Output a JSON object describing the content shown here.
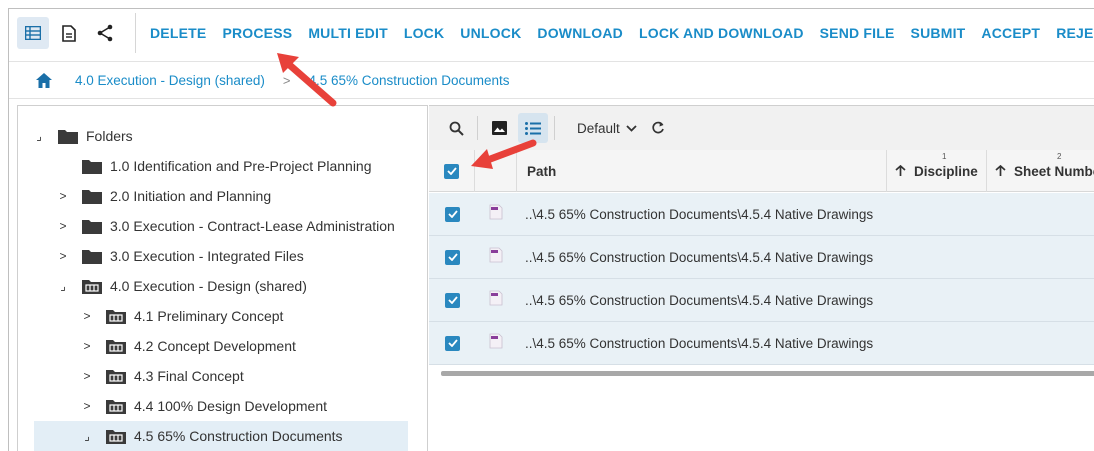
{
  "toolbar": {
    "icons": [
      "grid-view-icon",
      "document-icon",
      "share-icon"
    ],
    "actions": [
      "DELETE",
      "PROCESS",
      "MULTI EDIT",
      "LOCK",
      "UNLOCK",
      "DOWNLOAD",
      "LOCK AND DOWNLOAD",
      "SEND FILE",
      "SUBMIT",
      "ACCEPT",
      "REJECT"
    ]
  },
  "breadcrumb": {
    "items": [
      "4.0 Execution - Design (shared)",
      "4.5 65% Construction Documents"
    ],
    "separator": ">"
  },
  "tree": {
    "root": "Folders",
    "items": [
      {
        "label": "1.0 Identification and Pre-Project Planning",
        "twist": ""
      },
      {
        "label": "2.0 Initiation and Planning",
        "twist": ">"
      },
      {
        "label": "3.0 Execution - Contract-Lease Administration",
        "twist": ">"
      },
      {
        "label": "3.0 Execution - Integrated Files",
        "twist": ">"
      },
      {
        "label": "4.0 Execution - Design (shared)",
        "twist": "⌟"
      },
      {
        "label": "4.1 Preliminary Concept",
        "twist": ">"
      },
      {
        "label": "4.2 Concept Development",
        "twist": ">"
      },
      {
        "label": "4.3 Final Concept",
        "twist": ">"
      },
      {
        "label": "4.4 100% Design Development",
        "twist": ">"
      },
      {
        "label": "4.5 65% Construction Documents",
        "twist": "⌟"
      }
    ]
  },
  "grid": {
    "view": "Default",
    "columns": [
      {
        "label": "Path",
        "num": ""
      },
      {
        "label": "Discipline",
        "num": "1"
      },
      {
        "label": "Sheet Numbe",
        "num": "2"
      }
    ],
    "rows": [
      {
        "path": "..\\4.5 65% Construction Documents\\4.5.4 Native Drawings",
        "checked": true
      },
      {
        "path": "..\\4.5 65% Construction Documents\\4.5.4 Native Drawings",
        "checked": true
      },
      {
        "path": "..\\4.5 65% Construction Documents\\4.5.4 Native Drawings",
        "checked": true
      },
      {
        "path": "..\\4.5 65% Construction Documents\\4.5.4 Native Drawings",
        "checked": true
      }
    ]
  },
  "colors": {
    "accent": "#1a8cc8",
    "checkbox": "#2a88bf",
    "annotation_arrow": "#e8413a",
    "row_selected": "#e9f1f6"
  }
}
